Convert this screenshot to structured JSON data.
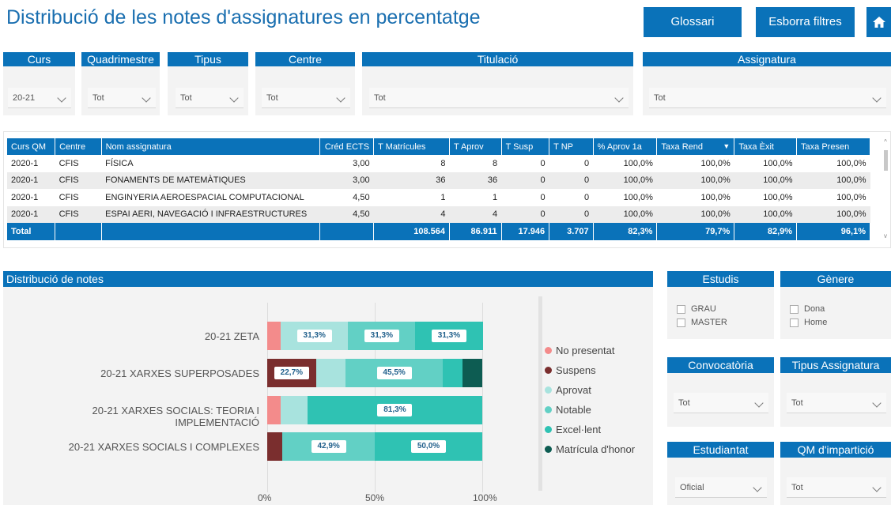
{
  "header": {
    "title": "Distribució de les notes d'assignatures en percentatge",
    "glossari": "Glossari",
    "esborra": "Esborra filtres",
    "home_icon": "home-icon"
  },
  "filters": {
    "curs": {
      "label": "Curs",
      "value": "20-21"
    },
    "quadrimestre": {
      "label": "Quadrimestre",
      "value": "Tot"
    },
    "tipus": {
      "label": "Tipus",
      "value": "Tot"
    },
    "centre": {
      "label": "Centre",
      "value": "Tot"
    },
    "titulacio": {
      "label": "Titulació",
      "value": "Tot"
    },
    "assignatura": {
      "label": "Assignatura",
      "value": "Tot"
    }
  },
  "table": {
    "headers": [
      "Curs QM",
      "Centre",
      "Nom assignatura",
      "Créd ECTS",
      "T Matrícules",
      "T Aprov",
      "T Susp",
      "T NP",
      "% Aprov 1a",
      "Taxa Rend",
      "Taxa Èxit",
      "Taxa Presen"
    ],
    "rows": [
      [
        "2020-1",
        "CFIS",
        "FÍSICA",
        "3,00",
        "8",
        "8",
        "0",
        "0",
        "100,0%",
        "100,0%",
        "100,0%",
        "100,0%"
      ],
      [
        "2020-1",
        "CFIS",
        "FONAMENTS DE MATEMÀTIQUES",
        "3,00",
        "36",
        "36",
        "0",
        "0",
        "100,0%",
        "100,0%",
        "100,0%",
        "100,0%"
      ],
      [
        "2020-1",
        "CFIS",
        "ENGINYERIA AEROESPACIAL COMPUTACIONAL",
        "4,50",
        "1",
        "1",
        "0",
        "0",
        "100,0%",
        "100,0%",
        "100,0%",
        "100,0%"
      ],
      [
        "2020-1",
        "CFIS",
        "ESPAI AERI, NAVEGACIÓ I INFRAESTRUCTURES",
        "4,50",
        "4",
        "4",
        "0",
        "0",
        "100,0%",
        "100,0%",
        "100,0%",
        "100,0%"
      ]
    ],
    "total": [
      "Total",
      "",
      "",
      "",
      "108.564",
      "86.911",
      "17.946",
      "3.707",
      "82,3%",
      "79,7%",
      "82,9%",
      "96,1%"
    ]
  },
  "side_filters": {
    "estudis": {
      "label": "Estudis",
      "options": [
        "GRAU",
        "MASTER"
      ]
    },
    "genere": {
      "label": "Gènere",
      "options": [
        "Dona",
        "Home"
      ]
    },
    "convocatoria": {
      "label": "Convocatòria",
      "value": "Tot"
    },
    "tipus_assignatura": {
      "label": "Tipus Assignatura",
      "value": "Tot"
    },
    "estudiantat": {
      "label": "Estudiantat",
      "value": "Oficial"
    },
    "qm_imparticio": {
      "label": "QM d'impartició",
      "value": "Tot"
    }
  },
  "chart_panel_title": "Distribució de notes",
  "colors": {
    "accent": "#0a72b9",
    "no_presentat": "#f38b8b",
    "suspens": "#7a2e2e",
    "aprovat": "#a8e3de",
    "notable": "#62d0c5",
    "excellent": "#2fc2b3",
    "matricula": "#0d5c52"
  },
  "chart_data": {
    "type": "bar",
    "orientation": "horizontal",
    "stacked": "100%",
    "categories": [
      "20-21 ZETA",
      "20-21 XARXES SUPERPOSADES",
      "20-21 XARXES SOCIALS: TEORIA I IMPLEMENTACIÓ",
      "20-21 XARXES SOCIALS I COMPLEXES"
    ],
    "series": [
      {
        "name": "No presentat",
        "values": [
          6.3,
          0,
          6.3,
          0
        ]
      },
      {
        "name": "Suspens",
        "values": [
          0,
          22.7,
          0,
          7.1
        ]
      },
      {
        "name": "Aprovat",
        "values": [
          31.3,
          13.6,
          12.4,
          0
        ]
      },
      {
        "name": "Notable",
        "values": [
          31.3,
          45.5,
          0,
          42.9
        ]
      },
      {
        "name": "Excel·lent",
        "values": [
          31.3,
          9.1,
          81.3,
          50.0
        ]
      },
      {
        "name": "Matrícula d'honor",
        "values": [
          0,
          9.1,
          0,
          0
        ]
      }
    ],
    "data_labels": [
      [
        null,
        null,
        "31,3%",
        "31,3%",
        "31,3%",
        null
      ],
      [
        null,
        "22,7%",
        null,
        "45,5%",
        null,
        null
      ],
      [
        null,
        null,
        null,
        null,
        "81,3%",
        null
      ],
      [
        null,
        null,
        null,
        "42,9%",
        "50,0%",
        null
      ]
    ],
    "x_ticks": [
      "0%",
      "50%",
      "100%"
    ],
    "xlim": [
      0,
      100
    ],
    "legend_position": "right"
  }
}
